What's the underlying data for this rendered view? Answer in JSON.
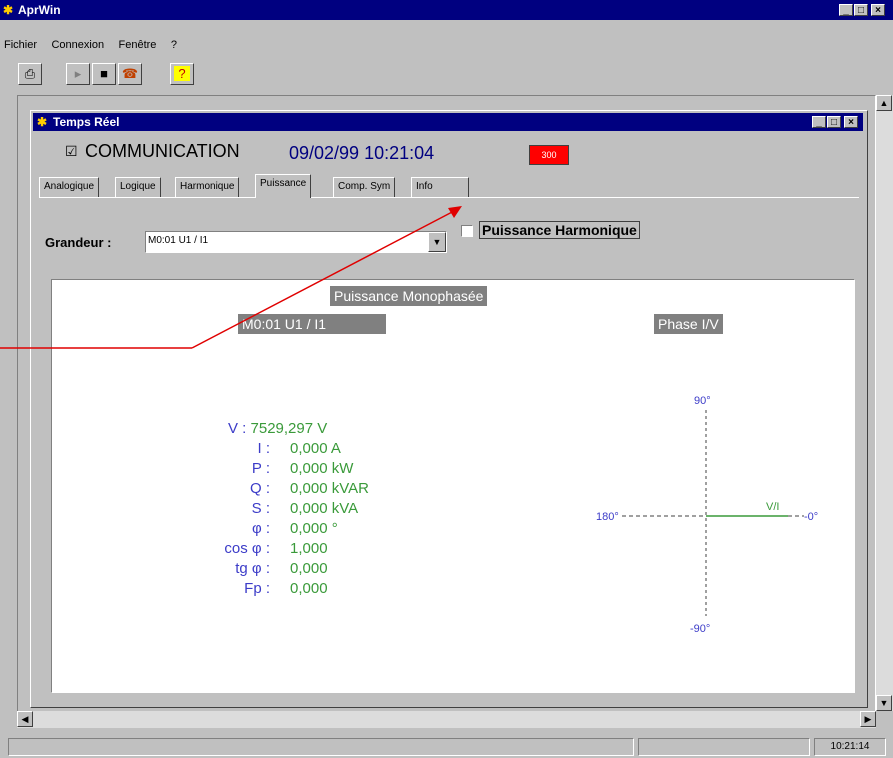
{
  "app": {
    "title": "AprWin"
  },
  "menu": [
    "Fichier",
    "Connexion",
    "Fenêtre",
    "?"
  ],
  "toolbar": {
    "icons": [
      "printer-icon",
      "play-icon",
      "stop-icon",
      "connect-icon",
      "help-icon"
    ],
    "help_label": "?"
  },
  "child": {
    "title": "Temps Réel",
    "comm_label": "COMMUNICATION",
    "comm_checked": true,
    "datetime": "09/02/99 10:21:04",
    "indicator": "300",
    "indicator_color": "#ff0000"
  },
  "tabs": [
    "Analogique",
    "Logique",
    "Harmonique",
    "Puissance",
    "Comp. Sym",
    "Info"
  ],
  "active_tab": "Puissance",
  "grandeur": {
    "label": "Grandeur :",
    "value": "M0:01 U1 / I1"
  },
  "puissance_harmonique": {
    "label": "Puissance Harmonique",
    "checked": false
  },
  "panel": {
    "title": "Puissance Monophasée",
    "source": "M0:01 U1 / I1",
    "phase_title": "Phase I/V",
    "measurements": [
      {
        "label": "V :",
        "value": "7529,297 V"
      },
      {
        "label": "I :",
        "value": "0,000 A"
      },
      {
        "label": "P :",
        "value": "0,000 kW"
      },
      {
        "label": "Q :",
        "value": "0,000 kVAR"
      },
      {
        "label": "S :",
        "value": "0,000 kVA"
      },
      {
        "label": "φ :",
        "value": "0,000 °"
      },
      {
        "label": "cos φ :",
        "value": "1,000"
      },
      {
        "label": "tg φ :",
        "value": "0,000"
      },
      {
        "label": "Fp :",
        "value": "0,000"
      }
    ],
    "phase_labels": {
      "top": "90°",
      "bottom": "-90°",
      "left": "180°",
      "right": "-0°",
      "vector": "V/I"
    }
  },
  "status": {
    "time": "10:21:14"
  },
  "colors": {
    "titlebar": "#000080",
    "values": "#3a9a3a",
    "labels": "#3c3cc8",
    "arrow": "#e00000"
  }
}
